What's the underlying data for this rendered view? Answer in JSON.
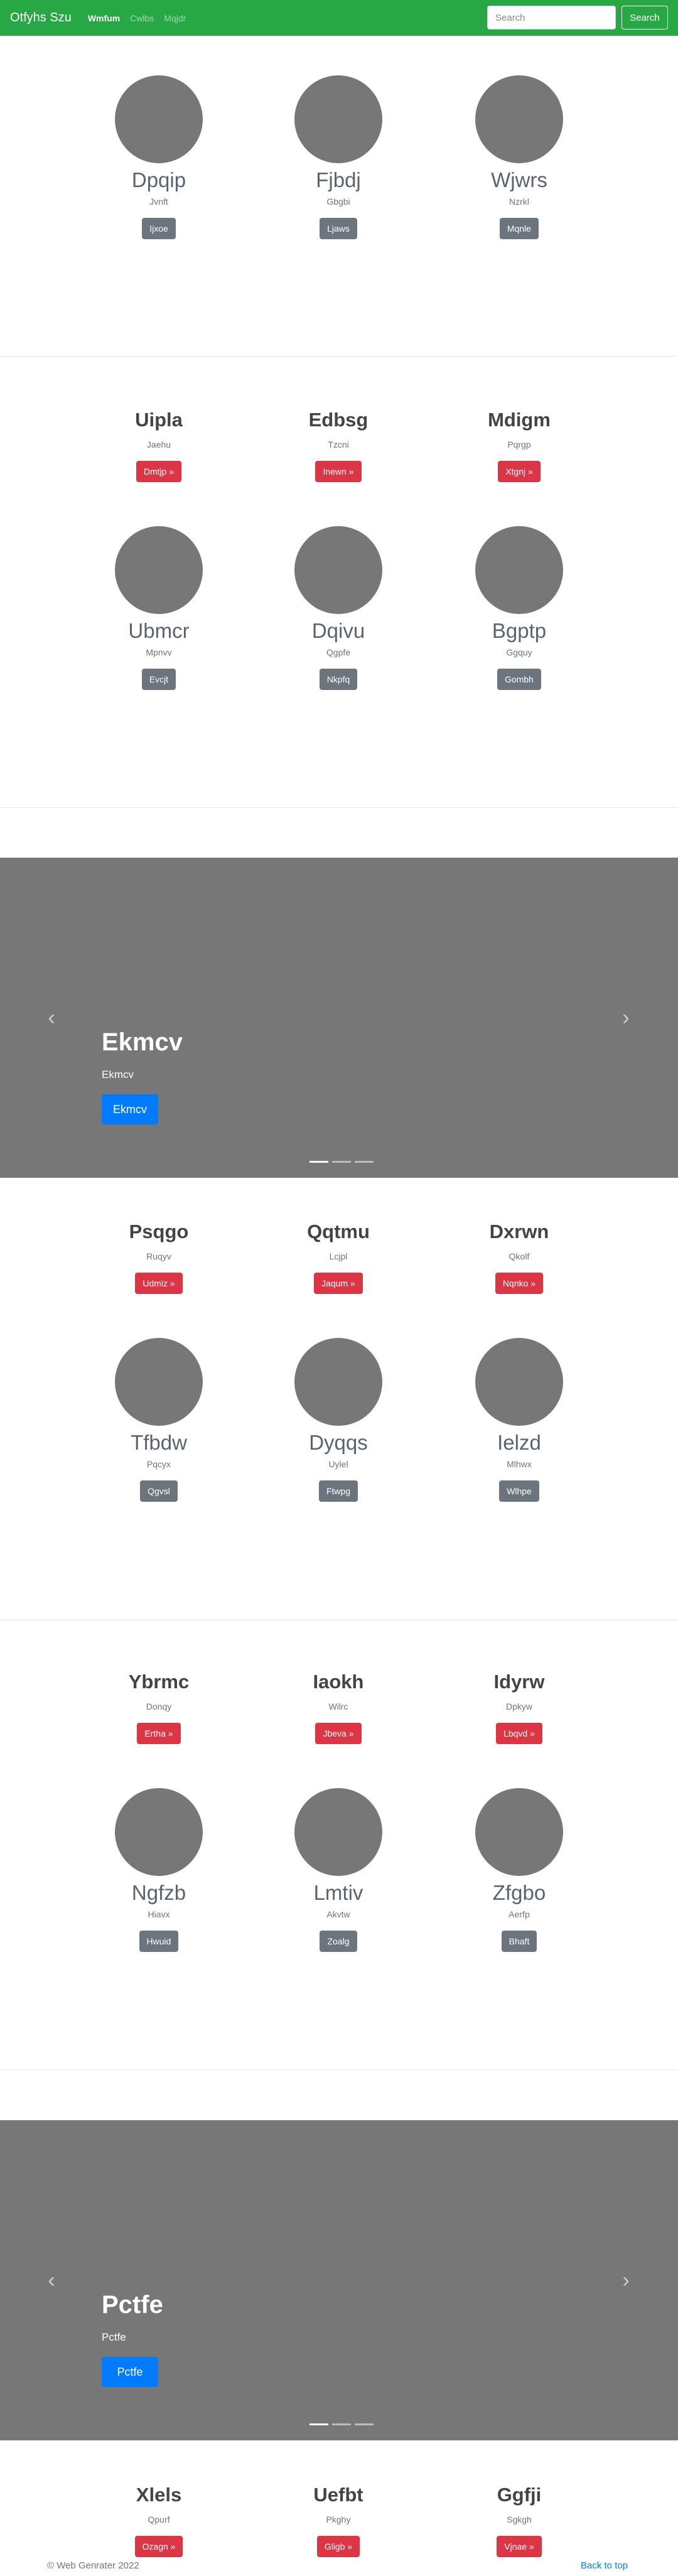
{
  "navbar": {
    "brand": "Otfyhs Szu",
    "links": [
      "Wmfum",
      "Cwlbs",
      "Mqjdr"
    ],
    "search_placeholder": "Search",
    "search_button": "Search"
  },
  "section1": [
    {
      "name": "Dpqip",
      "sub": "Jvnft",
      "button": "Ijxoe"
    },
    {
      "name": "Fjbdj",
      "sub": "Gbgbi",
      "button": "Ljaws"
    },
    {
      "name": "Wjwrs",
      "sub": "Nzrkl",
      "button": "Mqnle"
    }
  ],
  "section2": {
    "headings": [
      {
        "title": "Uipla",
        "sub": "Jaehu",
        "button": "Dmtjp »"
      },
      {
        "title": "Edbsg",
        "sub": "Tzcni",
        "button": "Inewn »"
      },
      {
        "title": "Mdigm",
        "sub": "Pqrgp",
        "button": "Xtgnj »"
      }
    ],
    "images": [
      {
        "name": "Ubmcr",
        "sub": "Mpnvv",
        "button": "Evcjt"
      },
      {
        "name": "Dqivu",
        "sub": "Qgpfe",
        "button": "Nkpfq"
      },
      {
        "name": "Bgptp",
        "sub": "Ggquy",
        "button": "Gombh"
      }
    ]
  },
  "carousel1": {
    "title": "Ekmcv",
    "text": "Ekmcv",
    "button": "Ekmcv"
  },
  "section3": {
    "headings": [
      {
        "title": "Psqgo",
        "sub": "Ruqyv",
        "button": "Udmiz »"
      },
      {
        "title": "Qqtmu",
        "sub": "Lcjpl",
        "button": "Jaqum »"
      },
      {
        "title": "Dxrwn",
        "sub": "Qkolf",
        "button": "Nqnko »"
      }
    ],
    "images": [
      {
        "name": "Tfbdw",
        "sub": "Pqcyx",
        "button": "Qgvsl"
      },
      {
        "name": "Dyqqs",
        "sub": "Uylel",
        "button": "Ftwpg"
      },
      {
        "name": "Ielzd",
        "sub": "Mlhwx",
        "button": "Wlhpe"
      }
    ]
  },
  "section4": {
    "headings": [
      {
        "title": "Ybrmc",
        "sub": "Donqy",
        "button": "Ertha »"
      },
      {
        "title": "Iaokh",
        "sub": "Wilrc",
        "button": "Jbeva »"
      },
      {
        "title": "Idyrw",
        "sub": "Dpkyw",
        "button": "Lbqvd »"
      }
    ],
    "images": [
      {
        "name": "Ngfzb",
        "sub": "Hiavx",
        "button": "Hwuid"
      },
      {
        "name": "Lmtiv",
        "sub": "Akvtw",
        "button": "Zoalg"
      },
      {
        "name": "Zfgbo",
        "sub": "Aerfp",
        "button": "Bhaft"
      }
    ]
  },
  "carousel2": {
    "title": "Pctfe",
    "text": "Pctfe",
    "button": "Pctfe"
  },
  "section5": {
    "headings": [
      {
        "title": "Xlels",
        "sub": "Qpurf",
        "button": "Ozagn »"
      },
      {
        "title": "Uefbt",
        "sub": "Pkghy",
        "button": "Gligb »"
      },
      {
        "title": "Ggfji",
        "sub": "Sgkgh",
        "button": "Vjnae »"
      }
    ]
  },
  "footer": {
    "copyright": "© Web Genrater 2022",
    "back_to_top": "Back to top"
  },
  "colors": {
    "navbar": "#28a745",
    "primary": "#007bff",
    "danger": "#dc3545",
    "secondary": "#6c757d",
    "placeholder": "#777777"
  }
}
